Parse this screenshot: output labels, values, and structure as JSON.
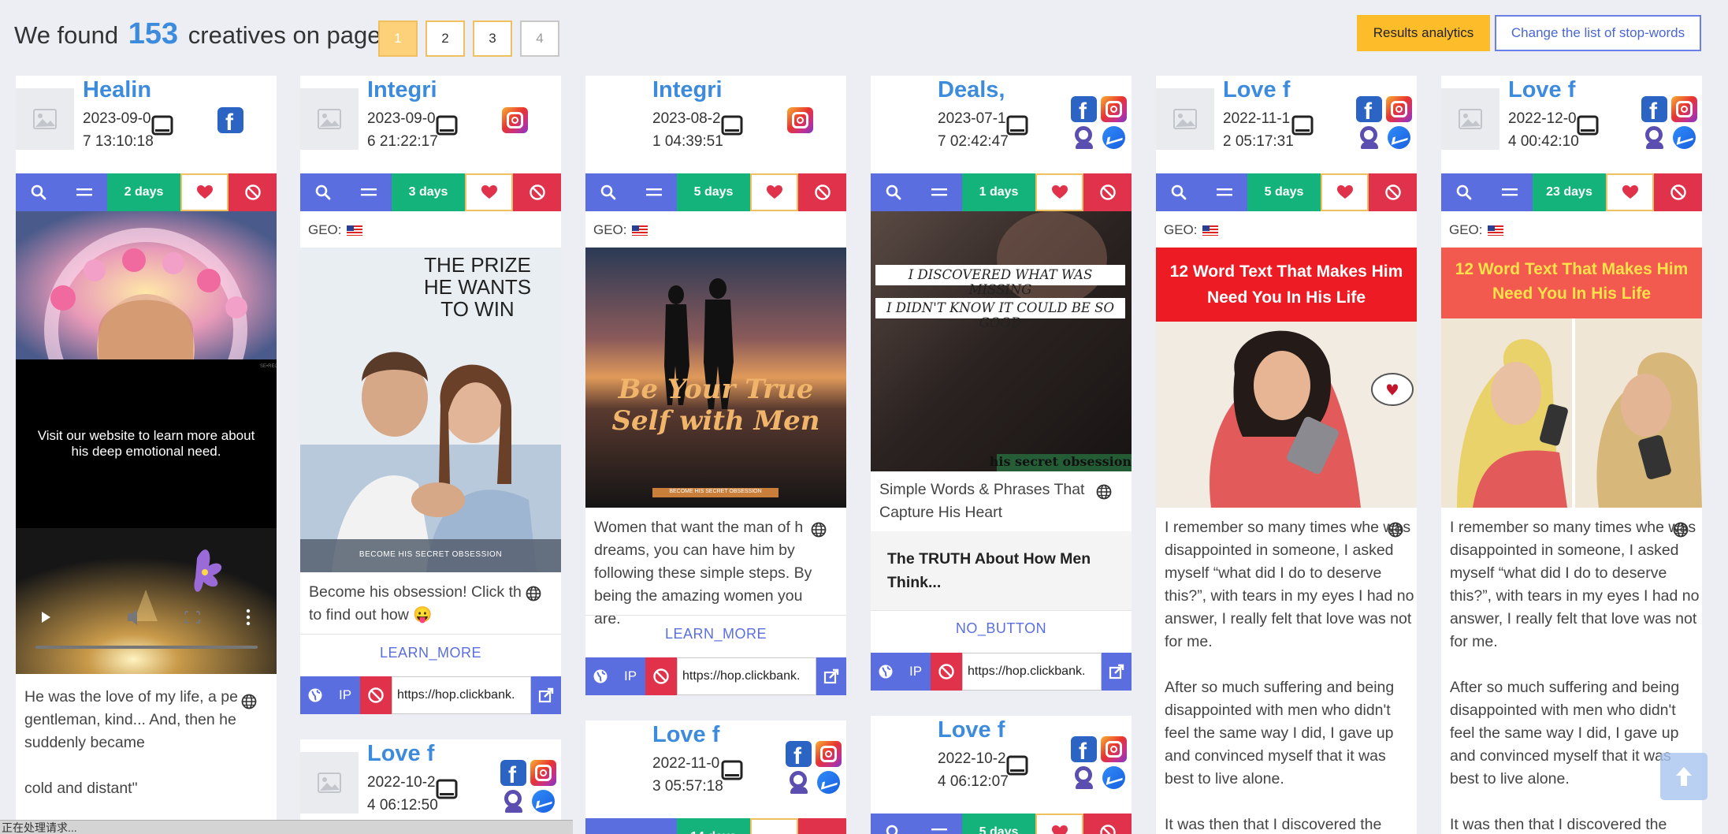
{
  "header": {
    "found_prefix": "We found",
    "count": "153",
    "found_suffix": "creatives on pages:",
    "pages": [
      "1",
      "2",
      "3",
      "4"
    ],
    "analytics_label": "Results analytics",
    "stopwords_label": "Change the list of stop-words"
  },
  "geo_label": "GEO:",
  "cards": [
    {
      "title": "Healin",
      "date": "2023-09-07 13:10:18",
      "days": "2 days",
      "video_text": "Visit our website to learn more about his deep emotional need.",
      "text": "He was the love of my life, a pe gentleman, kind... And, then he suddenly became\n\ncold and distant\""
    },
    {
      "title": "Integri",
      "date": "2023-09-06 21:22:17",
      "days": "3 days",
      "img_headline": "THE PRIZE HE WANTS TO WIN",
      "img_footer": "BECOME HIS SECRET OBSESSION",
      "text": "Become his obsession! Click th to find out how 😛",
      "cta": "LEARN_MORE",
      "url": "https://hop.clickbank.",
      "next_title": "Love f",
      "next_date": "2022-10-24 06:12:50"
    },
    {
      "title": "Integri",
      "date": "2023-08-21 04:39:51",
      "days": "5 days",
      "img_headline": "Be Your True Self with Men",
      "img_footer": "BECOME HIS SECRET OBSESSION",
      "text": "Women that want the man of h dreams, you can have him by following these simple steps. By being the amazing women you are.",
      "cta": "LEARN_MORE",
      "url": "https://hop.clickbank.",
      "next_title": "Love f",
      "next_date": "2022-11-03 05:57:18",
      "next_days": "14 days"
    },
    {
      "title": "Deals,",
      "date": "2023-07-17 02:42:47",
      "days": "1 days",
      "img_line1": "I DISCOVERED WHAT WAS MISSING",
      "img_line2": "I DIDN'T KNOW IT COULD BE SO GOOD",
      "img_footer": "his secret obsession",
      "text": "Simple Words & Phrases That Capture His Heart",
      "landing": "The TRUTH About How Men Think...",
      "cta": "NO_BUTTON",
      "url": "https://hop.clickbank.",
      "next_title": "Love f",
      "next_date": "2022-10-24 06:12:07",
      "next_days": "5 days"
    },
    {
      "title": "Love f",
      "date": "2022-11-12 05:17:31",
      "days": "5 days",
      "img_headline": "12 Word Text That Makes Him Need You In His Life",
      "text": "I remember so many times whe was disappointed in someone, I asked myself “what did I do to deserve this?”, with tears in my eyes I had no answer, I really felt that love was not for me.\n\nAfter so much suffering and being disappointed with men who didn't feel the same way I did, I gave up and convinced myself that it was best to live alone.\n\nIt was then that I discovered the"
    },
    {
      "title": "Love f",
      "date": "2022-12-04 00:42:10",
      "days": "23 days",
      "img_headline": "12 Word Text That Makes Him Need You In His Life",
      "text": "I remember so many times whe was disappointed in someone, I asked myself “what did I do to deserve this?”, with tears in my eyes I had no answer, I really felt that love was not for me.\n\nAfter so much suffering and being disappointed with men who didn't feel the same way I did, I gave up and convinced myself that it was best to live alone.\n\nIt was then that I discovered the"
    }
  ],
  "status_text": "正在处理请求...",
  "colors": {
    "accent": "#3d8bdd",
    "primary": "#5a6ee0",
    "success": "#15b37c",
    "danger": "#e0324a",
    "warning": "#fdbd2a"
  }
}
